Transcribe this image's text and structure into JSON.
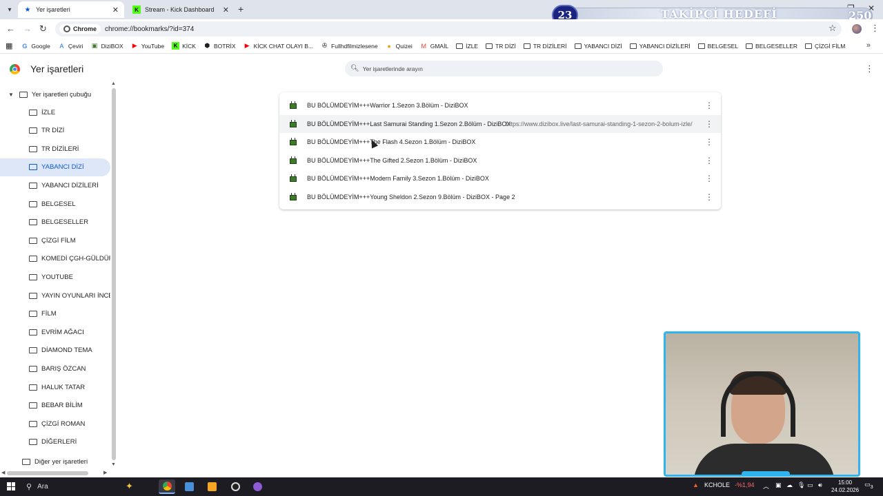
{
  "tabs": [
    {
      "title": "Yer işaretleri",
      "icon": "star-icon",
      "active": true
    },
    {
      "title": "Stream - Kick Dashboard",
      "icon": "kick-icon",
      "active": false
    }
  ],
  "overlay": {
    "count": "23",
    "title": "TAKİPÇİ HEDEFİ",
    "goal": "250"
  },
  "address": {
    "chip_label": "Chrome",
    "url": "chrome://bookmarks/?id=374"
  },
  "bookmarks_bar": [
    {
      "label": "Google",
      "icon": "google-icon"
    },
    {
      "label": "Çeviri",
      "icon": "translate-icon"
    },
    {
      "label": "DiziBOX",
      "icon": "tv-icon"
    },
    {
      "label": "YouTube",
      "icon": "youtube-icon"
    },
    {
      "label": "KİCK",
      "icon": "kick-icon"
    },
    {
      "label": "BOTRİX",
      "icon": "botrix-icon"
    },
    {
      "label": "KİCK CHAT OLAYI B...",
      "icon": "youtube-icon"
    },
    {
      "label": "Fullhdfilmizlesene",
      "icon": "film-reel-icon"
    },
    {
      "label": "Quizei",
      "icon": "quiz-icon"
    },
    {
      "label": "GMAİL",
      "icon": "gmail-icon"
    },
    {
      "label": "İZLE",
      "icon": "folder-icon"
    },
    {
      "label": "TR DİZİ",
      "icon": "folder-icon"
    },
    {
      "label": "TR DİZİLERİ",
      "icon": "folder-icon"
    },
    {
      "label": "YABANCI DİZİ",
      "icon": "folder-icon"
    },
    {
      "label": "YABANCI DİZİLERİ",
      "icon": "folder-icon"
    },
    {
      "label": "BELGESEL",
      "icon": "folder-icon"
    },
    {
      "label": "BELGESELLER",
      "icon": "folder-icon"
    },
    {
      "label": "ÇİZGİ FİLM",
      "icon": "folder-icon"
    }
  ],
  "page": {
    "title": "Yer işaretleri",
    "search_placeholder": "Yer işaretlerinde arayın"
  },
  "sidebar": {
    "root": "Yer işaretleri çubuğu",
    "items": [
      "İZLE",
      "TR DİZİ",
      "TR DİZİLERİ",
      "YABANCI DİZİ",
      "YABANCI DİZİLERİ",
      "BELGESEL",
      "BELGESELLER",
      "ÇİZGİ FİLM",
      "KOMEDİ ÇGH-GÜLDÜR",
      "YOUTUBE",
      "YAYIN OYUNLARI İNCEL",
      "FİLM",
      "EVRİM AĞACI",
      "DİAMOND TEMA",
      "BARIŞ ÖZCAN",
      "HALUK TATAR",
      "BEBAR BİLİM",
      "ÇİZGİ ROMAN",
      "DİĞERLERİ"
    ],
    "selected": "YABANCI DİZİ",
    "other": "Diğer yer işaretleri"
  },
  "bookmarks": [
    {
      "title": "BU BÖLÜMDEYİM+++Warrior 1.Sezon 3.Bölüm - DiziBOX",
      "url": ""
    },
    {
      "title": "BU BÖLÜMDEYİM+++Last Samurai Standing 1.Sezon 2.Bölüm - DiziBOX",
      "url": "https://www.dizibox.live/last-samurai-standing-1-sezon-2-bolum-izle/"
    },
    {
      "title": "BU BÖLÜMDEYİM+++The Flash 4.Sezon 1.Bölüm - DiziBOX",
      "url": ""
    },
    {
      "title": "BU BÖLÜMDEYİM+++The Gifted 2.Sezon 1.Bölüm - DiziBOX",
      "url": ""
    },
    {
      "title": "BU BÖLÜMDEYİM+++Modern Family 3.Sezon 1.Bölüm - DiziBOX",
      "url": ""
    },
    {
      "title": "BU BÖLÜMDEYİM+++Young Sheldon 2.Sezon 9.Bölüm - DiziBOX - Page 2",
      "url": ""
    }
  ],
  "taskbar": {
    "search_label": "Ara",
    "stock_name": "KCHOLE",
    "stock_change": "-%1,94",
    "time": "15:00",
    "date": "24.02.2026",
    "notifications": "3"
  },
  "colors": {
    "accent": "#0b57d0",
    "selected_bg": "#dde7f8",
    "webcam_border": "#2fb4f0",
    "overlay_badge": "#1a237e",
    "stock_down": "#ff6b6b"
  }
}
